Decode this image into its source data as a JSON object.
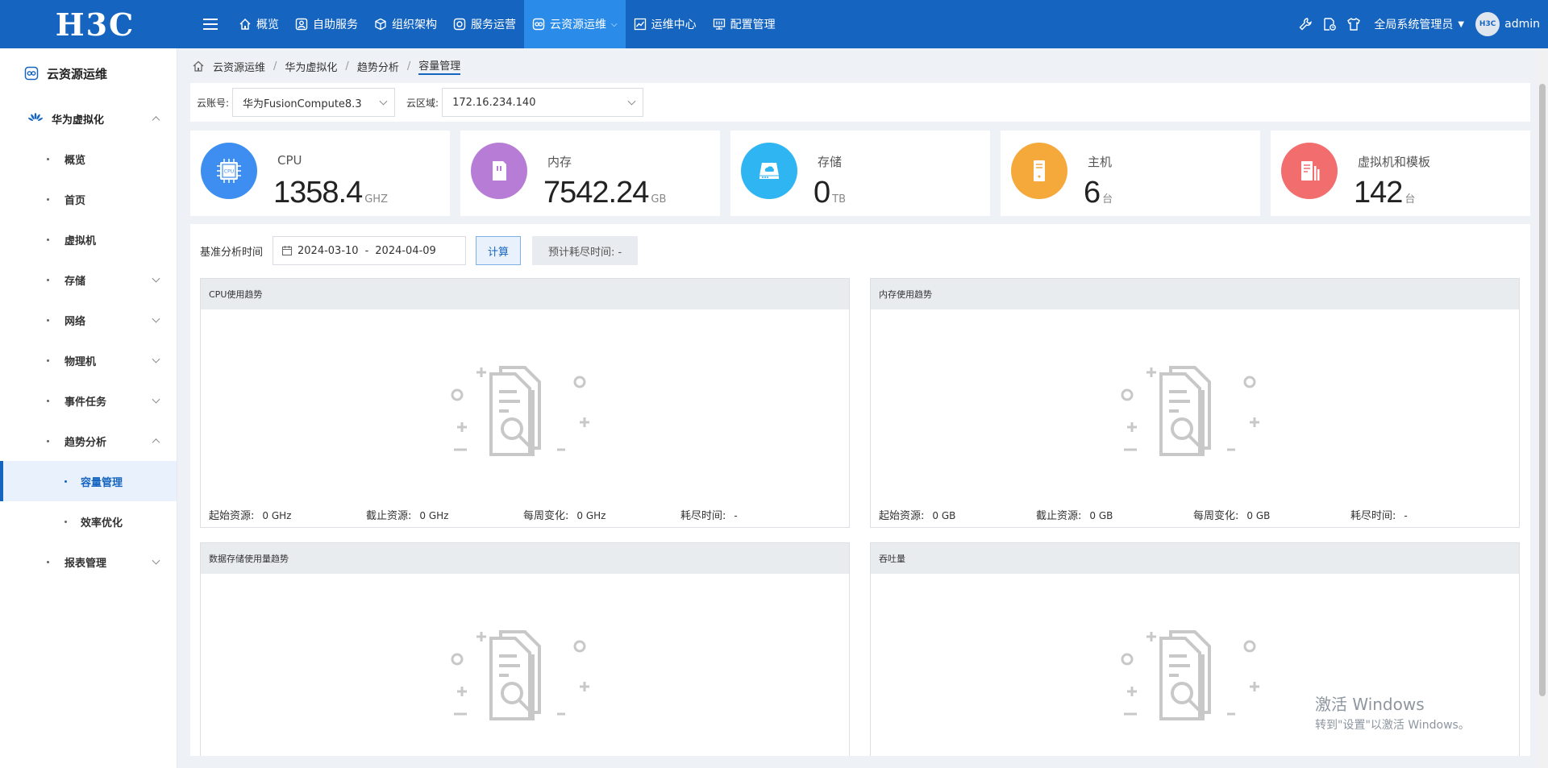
{
  "header": {
    "logo": "H3C",
    "nav": [
      {
        "label": "概览",
        "icon": "home-icon"
      },
      {
        "label": "自助服务",
        "icon": "user-icon"
      },
      {
        "label": "组织架构",
        "icon": "cube-icon"
      },
      {
        "label": "服务运营",
        "icon": "service-icon"
      },
      {
        "label": "云资源运维",
        "icon": "cloud-ops-icon",
        "active": true
      },
      {
        "label": "运维中心",
        "icon": "chart-icon"
      },
      {
        "label": "配置管理",
        "icon": "config-icon"
      }
    ],
    "role": "全局系统管理员",
    "avatar_text": "H3C",
    "username": "admin"
  },
  "sidebar": {
    "title": "云资源运维",
    "group": "华为虚拟化",
    "items": [
      {
        "label": "概览"
      },
      {
        "label": "首页"
      },
      {
        "label": "虚拟机"
      },
      {
        "label": "存储"
      },
      {
        "label": "网络"
      },
      {
        "label": "物理机"
      },
      {
        "label": "事件任务"
      },
      {
        "label": "趋势分析"
      }
    ],
    "sub_items": [
      {
        "label": "容量管理"
      },
      {
        "label": "效率优化"
      }
    ],
    "last_item": {
      "label": "报表管理"
    }
  },
  "breadcrumb": [
    "云资源运维",
    "华为虚拟化",
    "趋势分析",
    "容量管理"
  ],
  "filters": {
    "account_label": "云账号:",
    "account_value": "华为FusionCompute8.3",
    "region_label": "云区域:",
    "region_value": "172.16.234.140"
  },
  "stats": [
    {
      "name": "CPU",
      "value": "1358.4",
      "unit": "GHZ",
      "color": "#3d8ef0"
    },
    {
      "name": "内存",
      "value": "7542.24",
      "unit": "GB",
      "color": "#b77dd6"
    },
    {
      "name": "存储",
      "value": "0",
      "unit": "TB",
      "color": "#2fb5f2"
    },
    {
      "name": "主机",
      "value": "6",
      "unit": "台",
      "color": "#f5a93b"
    },
    {
      "name": "虚拟机和模板",
      "value": "142",
      "unit": "台",
      "color": "#f26d6d"
    }
  ],
  "analysis": {
    "label": "基准分析时间",
    "start": "2024-03-10",
    "sep": "-",
    "end": "2024-04-09",
    "calc_button": "计算",
    "estimate": "预计耗尽时间: -"
  },
  "charts": [
    {
      "title": "CPU使用趋势",
      "start_label": "起始资源:",
      "start": "0 GHz",
      "end_label": "截止资源:",
      "end": "0 GHz",
      "week_label": "每周变化:",
      "week": "0 GHz",
      "exhaust_label": "耗尽时间:",
      "exhaust": "-"
    },
    {
      "title": "内存使用趋势",
      "start_label": "起始资源:",
      "start": "0 GB",
      "end_label": "截止资源:",
      "end": "0 GB",
      "week_label": "每周变化:",
      "week": "0 GB",
      "exhaust_label": "耗尽时间:",
      "exhaust": "-"
    },
    {
      "title": "数据存储使用量趋势"
    },
    {
      "title": "吞吐量"
    }
  ],
  "watermark": {
    "line1": "激活 Windows",
    "line2": "转到\"设置\"以激活 Windows。"
  }
}
